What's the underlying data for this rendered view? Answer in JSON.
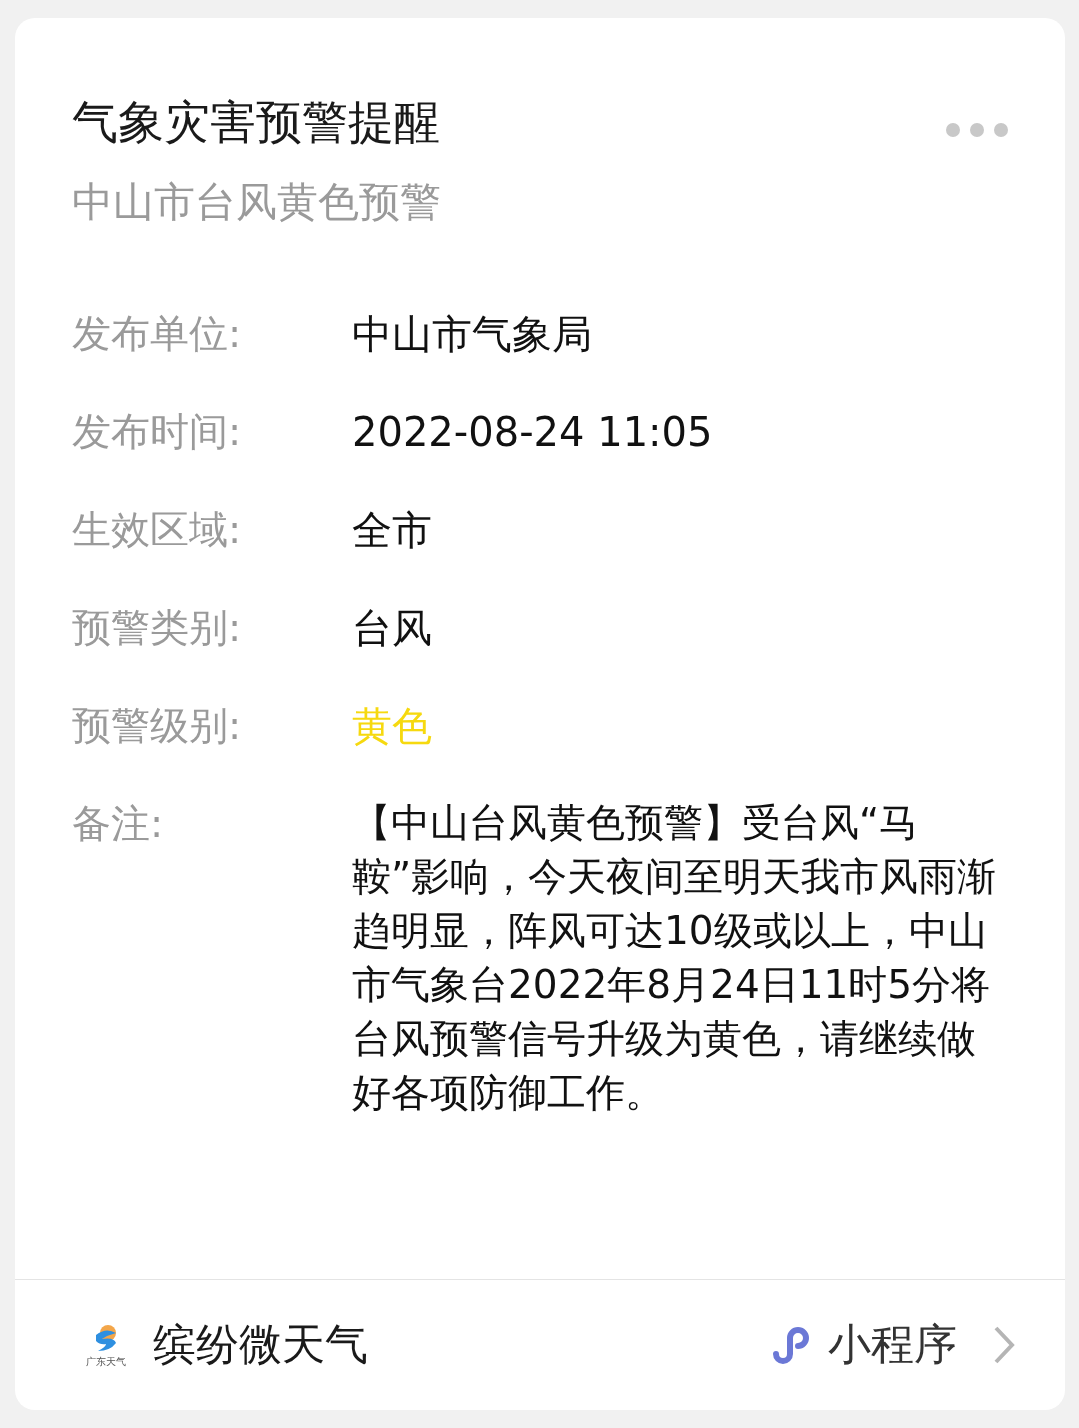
{
  "card": {
    "title": "气象灾害预警提醒",
    "subtitle": "中山市台风黄色预警",
    "fields": [
      {
        "label": "发布单位:",
        "value": "中山市气象局"
      },
      {
        "label": "发布时间:",
        "value": "2022-08-24 11:05"
      },
      {
        "label": "生效区域:",
        "value": "全市"
      },
      {
        "label": "预警类别:",
        "value": "台风"
      },
      {
        "label": "预警级别:",
        "value": "黄色",
        "color": "#f6d90f"
      }
    ],
    "note": {
      "label": "备注:",
      "text": "【中山台风黄色预警】受台风“马鞍”影响，今天夜间至明天我市风雨渐趋明显，阵风可达10级或以上，中山市气象台2022年8月24日11时5分将台风预警信号升级为黄色，请继续做好各项防御工作。"
    }
  },
  "footer": {
    "logo_caption": "广东天气",
    "app_name": "缤纷微天气",
    "tag": "小程序"
  }
}
